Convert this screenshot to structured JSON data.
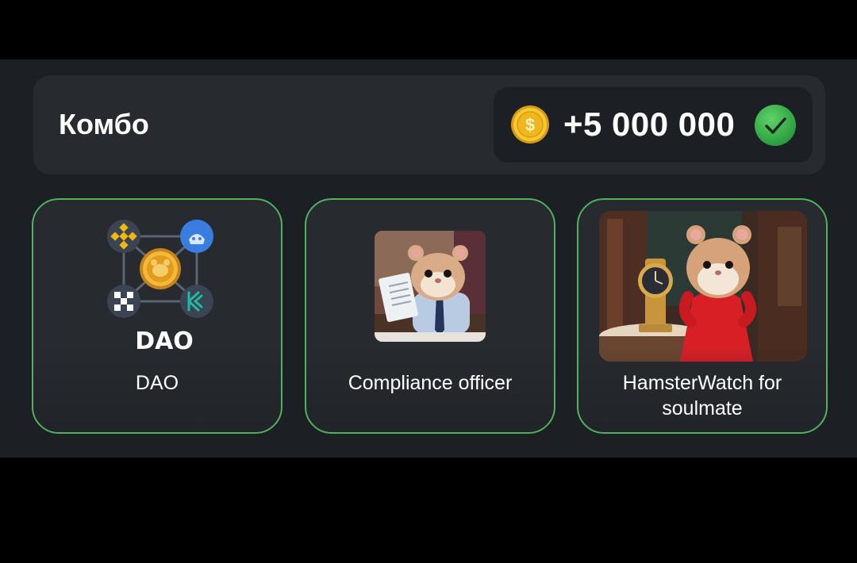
{
  "combo": {
    "title": "Комбо",
    "reward": "+5 000 000",
    "coin_icon": "gold-coin-dollar-icon",
    "status_icon": "green-check-icon"
  },
  "cards": [
    {
      "label": "DAO",
      "image_text": "DAO",
      "icon": "dao-network-icon"
    },
    {
      "label": "Compliance officer",
      "icon": "hamster-compliance-officer-image"
    },
    {
      "label": "HamsterWatch for soulmate",
      "icon": "hamster-watch-image"
    }
  ],
  "colors": {
    "background": "#000000",
    "panel": "#1c1f24",
    "card": "#272a2f",
    "card_border": "#4fb25c",
    "coin": "#f3c12b",
    "check": "#3fb950"
  }
}
